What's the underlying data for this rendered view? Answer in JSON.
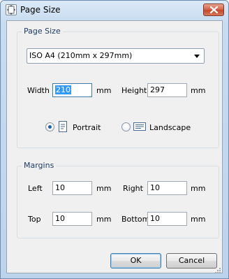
{
  "window": {
    "title": "Page Size"
  },
  "page_size_group": {
    "label": "Page Size",
    "preset_value": "ISO A4 (210mm x 297mm)",
    "width_label": "Width",
    "width_value": "210",
    "width_unit": "mm",
    "height_label": "Height",
    "height_value": "297",
    "height_unit": "mm",
    "portrait_label": "Portrait",
    "landscape_label": "Landscape",
    "orientation_selected": "Portrait"
  },
  "margins_group": {
    "label": "Margins",
    "left_label": "Left",
    "left_value": "10",
    "right_label": "Right",
    "right_value": "10",
    "top_label": "Top",
    "top_value": "10",
    "bottom_label": "Bottom",
    "bottom_value": "10",
    "unit": "mm"
  },
  "buttons": {
    "ok": "OK",
    "cancel": "Cancel"
  }
}
